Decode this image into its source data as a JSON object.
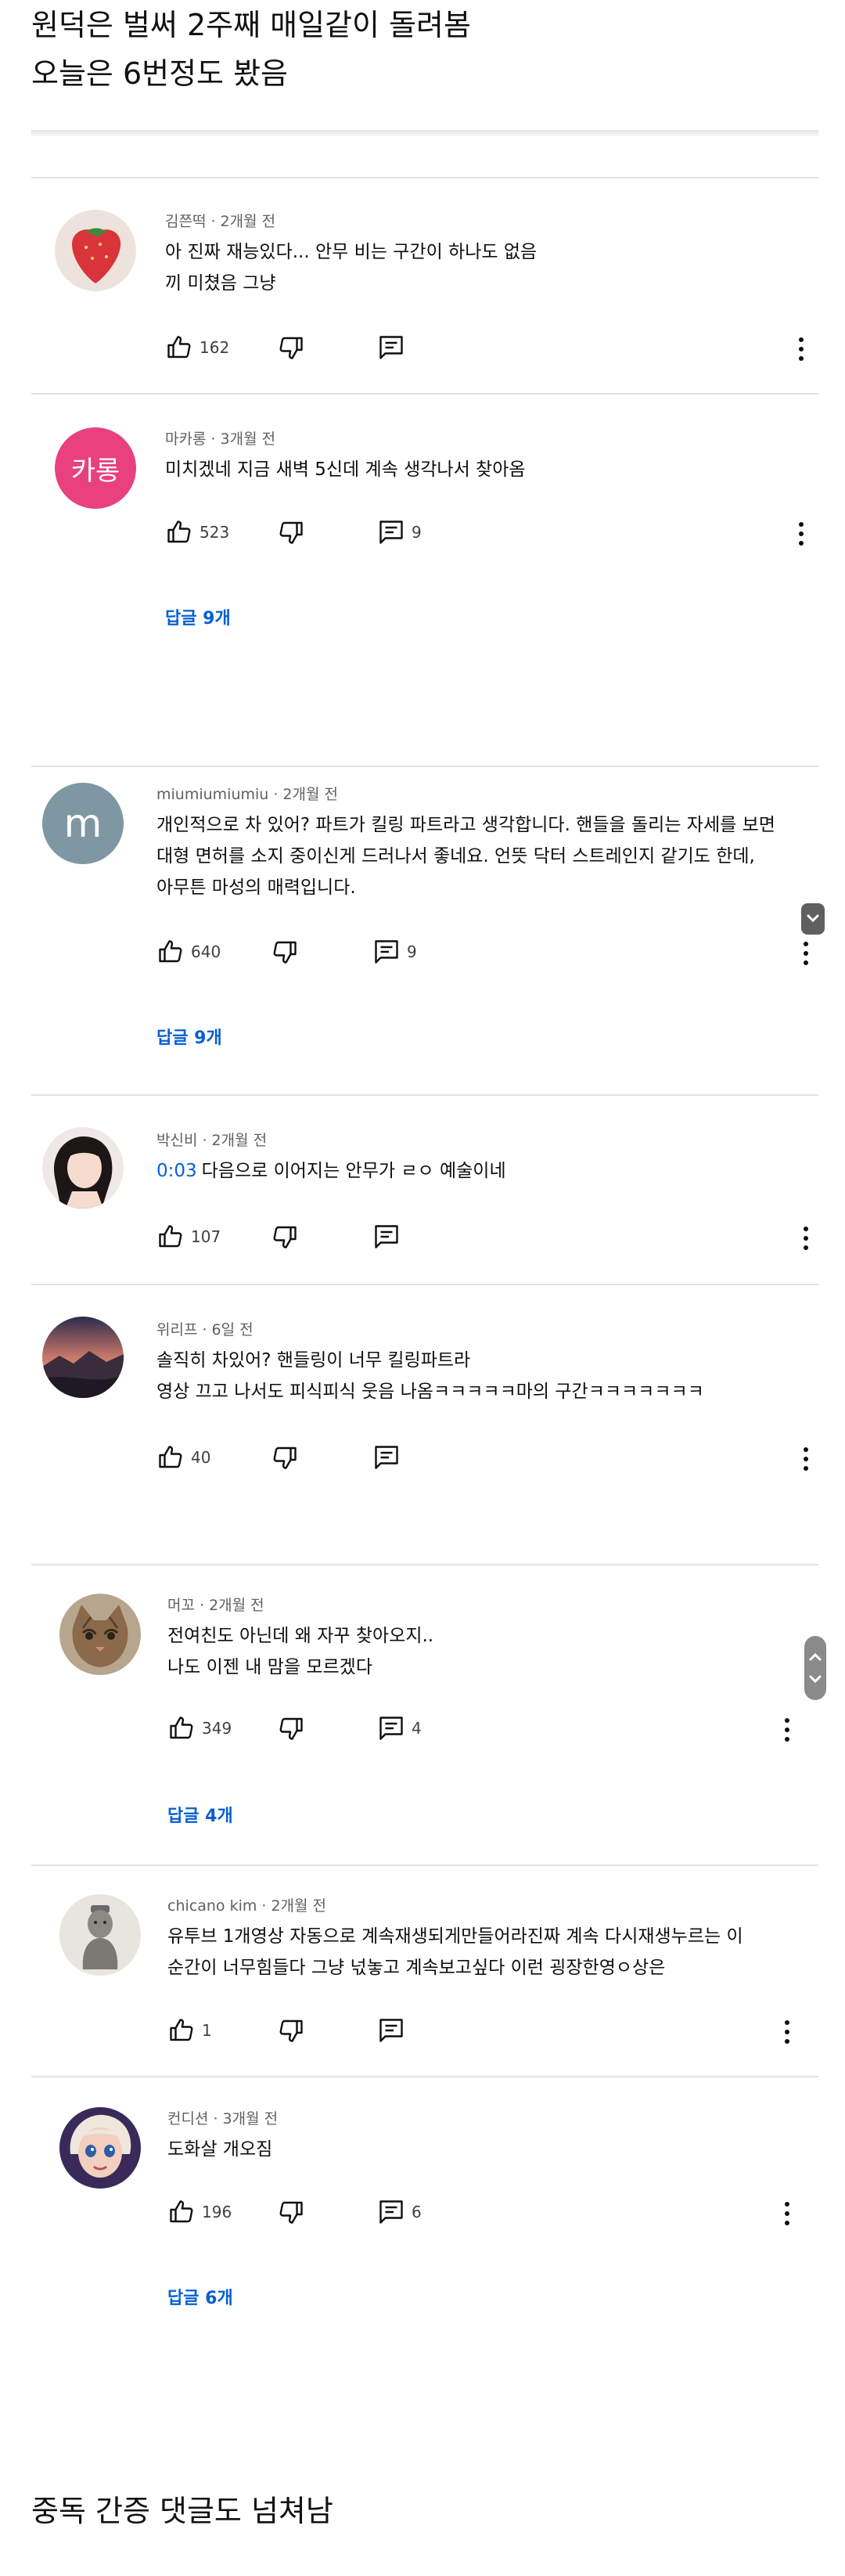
{
  "header": {
    "line1": "원덕은 벌써 2주째 매일같이 돌려봄",
    "line2": "오늘은 6번정도 봤음"
  },
  "comments": [
    {
      "author": "김쯘떡 · 2개월 전",
      "text": [
        "아 진짜 재능있다... 안무 비는 구간이 하나도 없음",
        "끼 미쳤음 그냥"
      ],
      "likes": "162",
      "replies_count": "",
      "replies_link": ""
    },
    {
      "author": "마카롱 · 3개월 전",
      "avatar_text": "카롱",
      "text": [
        "미치겠네 지금 새벽 5신데 계속 생각나서 찾아옴"
      ],
      "likes": "523",
      "replies_count": "9",
      "replies_link": "답글 9개"
    },
    {
      "author": "miumiumiumiu · 2개월 전",
      "avatar_text": "m",
      "text": [
        "개인적으로 차 있어? 파트가 킬링 파트라고 생각합니다. 핸들을 돌리는 자세를 보면",
        "대형 면허를 소지 중이신게 드러나서 좋네요. 언뜻 닥터 스트레인지 같기도 한데,",
        "아무튼 마성의 매력입니다."
      ],
      "likes": "640",
      "replies_count": "9",
      "replies_link": "답글 9개"
    },
    {
      "author": "박신비 · 2개월 전",
      "timestamp": "0:03",
      "text": [
        "다음으로 이어지는 안무가 ㄹㅇ 예술이네"
      ],
      "likes": "107",
      "replies_count": "",
      "replies_link": ""
    },
    {
      "author": "위리프 · 6일 전",
      "text": [
        "솔직히  차있어? 핸들링이 너무 킬링파트라",
        "영상 끄고 나서도 피식피식 웃음 나옴ㅋㅋㅋㅋㅋ마의 구간ㅋㅋㅋㅋㅋㅋㅋ"
      ],
      "likes": "40",
      "replies_count": "",
      "replies_link": ""
    },
    {
      "author": "머꼬 · 2개월 전",
      "text": [
        "전여친도 아닌데 왜 자꾸 찾아오지..",
        "나도 이젠 내 맘을 모르겠다"
      ],
      "likes": "349",
      "replies_count": "4",
      "replies_link": "답글 4개"
    },
    {
      "author": "chicano kim · 2개월 전",
      "text": [
        "유투브 1개영상 자동으로 계속재생되게만들어라진짜 계속 다시재생누르는 이",
        "순간이 너무힘들다 그냥 넋놓고 계속보고싶다 이런 굉장한영ㅇ상은"
      ],
      "likes": "1",
      "replies_count": "",
      "replies_link": ""
    },
    {
      "author": "컨디션 · 3개월 전",
      "text": [
        "도화살 개오짐"
      ],
      "likes": "196",
      "replies_count": "6",
      "replies_link": "답글 6개"
    }
  ],
  "footer": {
    "caption": "중독 간증 댓글도 넘쳐남"
  },
  "colors": {
    "link_blue": "#065fd4",
    "avatar_pink": "#e8417d",
    "avatar_slate": "#7f97a3"
  }
}
